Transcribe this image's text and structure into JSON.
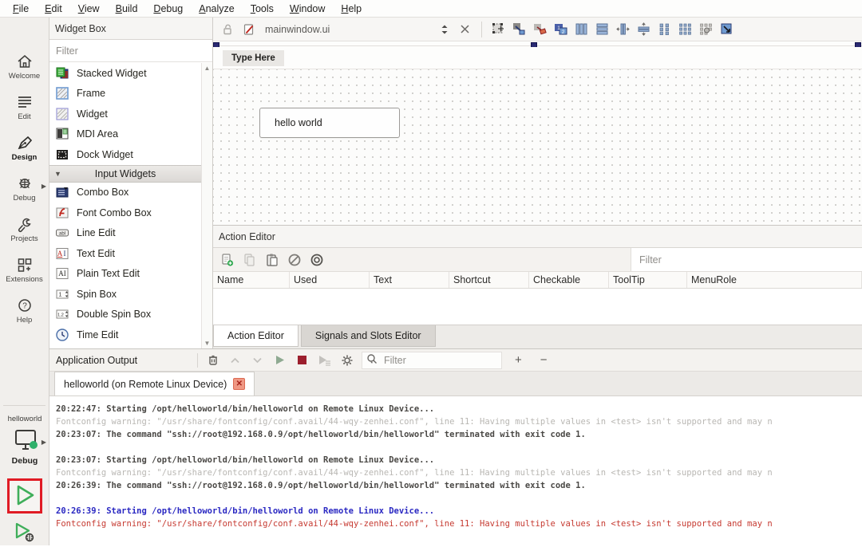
{
  "menubar": {
    "items": [
      "File",
      "Edit",
      "View",
      "Build",
      "Debug",
      "Analyze",
      "Tools",
      "Window",
      "Help"
    ]
  },
  "sidebar": {
    "modes": [
      {
        "label": "Welcome",
        "icon": "home-icon",
        "active": false
      },
      {
        "label": "Edit",
        "icon": "edit-lines-icon",
        "active": false
      },
      {
        "label": "Design",
        "icon": "pen-icon",
        "active": true
      },
      {
        "label": "Debug",
        "icon": "bug-icon",
        "active": false
      },
      {
        "label": "Projects",
        "icon": "wrench-icon",
        "active": false
      },
      {
        "label": "Extensions",
        "icon": "extensions-icon",
        "active": false
      },
      {
        "label": "Help",
        "icon": "help-icon",
        "active": false
      }
    ],
    "kit": {
      "project": "helloworld",
      "build_config": "Debug",
      "device_icon": "monitor-green-dot-icon"
    }
  },
  "widgetbox": {
    "title": "Widget Box",
    "filter_placeholder": "Filter",
    "items_top": [
      {
        "label": "Stacked Widget",
        "icon": "stacked-widget-icon"
      },
      {
        "label": "Frame",
        "icon": "frame-icon"
      },
      {
        "label": "Widget",
        "icon": "widget-icon"
      },
      {
        "label": "MDI Area",
        "icon": "mdi-area-icon"
      },
      {
        "label": "Dock Widget",
        "icon": "dock-widget-icon"
      }
    ],
    "category": "Input Widgets",
    "items_input": [
      {
        "label": "Combo Box",
        "icon": "combo-box-icon"
      },
      {
        "label": "Font Combo Box",
        "icon": "font-combo-box-icon"
      },
      {
        "label": "Line Edit",
        "icon": "line-edit-icon"
      },
      {
        "label": "Text Edit",
        "icon": "text-edit-icon"
      },
      {
        "label": "Plain Text Edit",
        "icon": "plain-text-edit-icon"
      },
      {
        "label": "Spin Box",
        "icon": "spin-box-icon"
      },
      {
        "label": "Double Spin Box",
        "icon": "double-spin-box-icon"
      },
      {
        "label": "Time Edit",
        "icon": "time-edit-icon"
      }
    ]
  },
  "designer": {
    "file_name": "mainwindow.ui",
    "form": {
      "menu_placeholder": "Type Here",
      "button_label": "hello world"
    }
  },
  "action_editor": {
    "title": "Action Editor",
    "filter_placeholder": "Filter",
    "columns": [
      "Name",
      "Used",
      "Text",
      "Shortcut",
      "Checkable",
      "ToolTip",
      "MenuRole"
    ],
    "tabs": [
      {
        "label": "Action Editor",
        "active": true
      },
      {
        "label": "Signals and Slots Editor",
        "active": false
      }
    ]
  },
  "output": {
    "title": "Application Output",
    "filter_placeholder": "Filter",
    "zoom_in": "+",
    "zoom_out": "−",
    "tab": {
      "label": "helloworld (on Remote Linux Device)"
    },
    "console": [
      {
        "text": "20:22:47: Starting /opt/helloworld/bin/helloworld on Remote Linux Device...",
        "style": "bold-dark"
      },
      {
        "text": "Fontconfig warning: \"/usr/share/fontconfig/conf.avail/44-wqy-zenhei.conf\", line 11: Having multiple values in <test> isn't supported and may n",
        "style": "muted-gray"
      },
      {
        "text": "20:23:07: The command \"ssh://root@192.168.0.9/opt/helloworld/bin/helloworld\" terminated with exit code 1.",
        "style": "bold-dark"
      },
      {
        "text": "",
        "style": "blank"
      },
      {
        "text": "20:23:07: Starting /opt/helloworld/bin/helloworld on Remote Linux Device...",
        "style": "bold-dark"
      },
      {
        "text": "Fontconfig warning: \"/usr/share/fontconfig/conf.avail/44-wqy-zenhei.conf\", line 11: Having multiple values in <test> isn't supported and may n",
        "style": "muted-gray"
      },
      {
        "text": "20:26:39: The command \"ssh://root@192.168.0.9/opt/helloworld/bin/helloworld\" terminated with exit code 1.",
        "style": "bold-dark"
      },
      {
        "text": "",
        "style": "blank"
      },
      {
        "text": "20:26:39: Starting /opt/helloworld/bin/helloworld on Remote Linux Device...",
        "style": "bold-blue"
      },
      {
        "text": "Fontconfig warning: \"/usr/share/fontconfig/conf.avail/44-wqy-zenhei.conf\", line 11: Having multiple values in <test> isn't supported and may n",
        "style": "error-red"
      }
    ]
  },
  "colors": {
    "run_highlight_red": "#e01b24",
    "run_green": "#3fae5a",
    "stop_red": "#9c1f2e",
    "console_blue": "#2a28c2",
    "console_error_red": "#c63a31",
    "selection_handle_navy": "#2a2a72"
  }
}
